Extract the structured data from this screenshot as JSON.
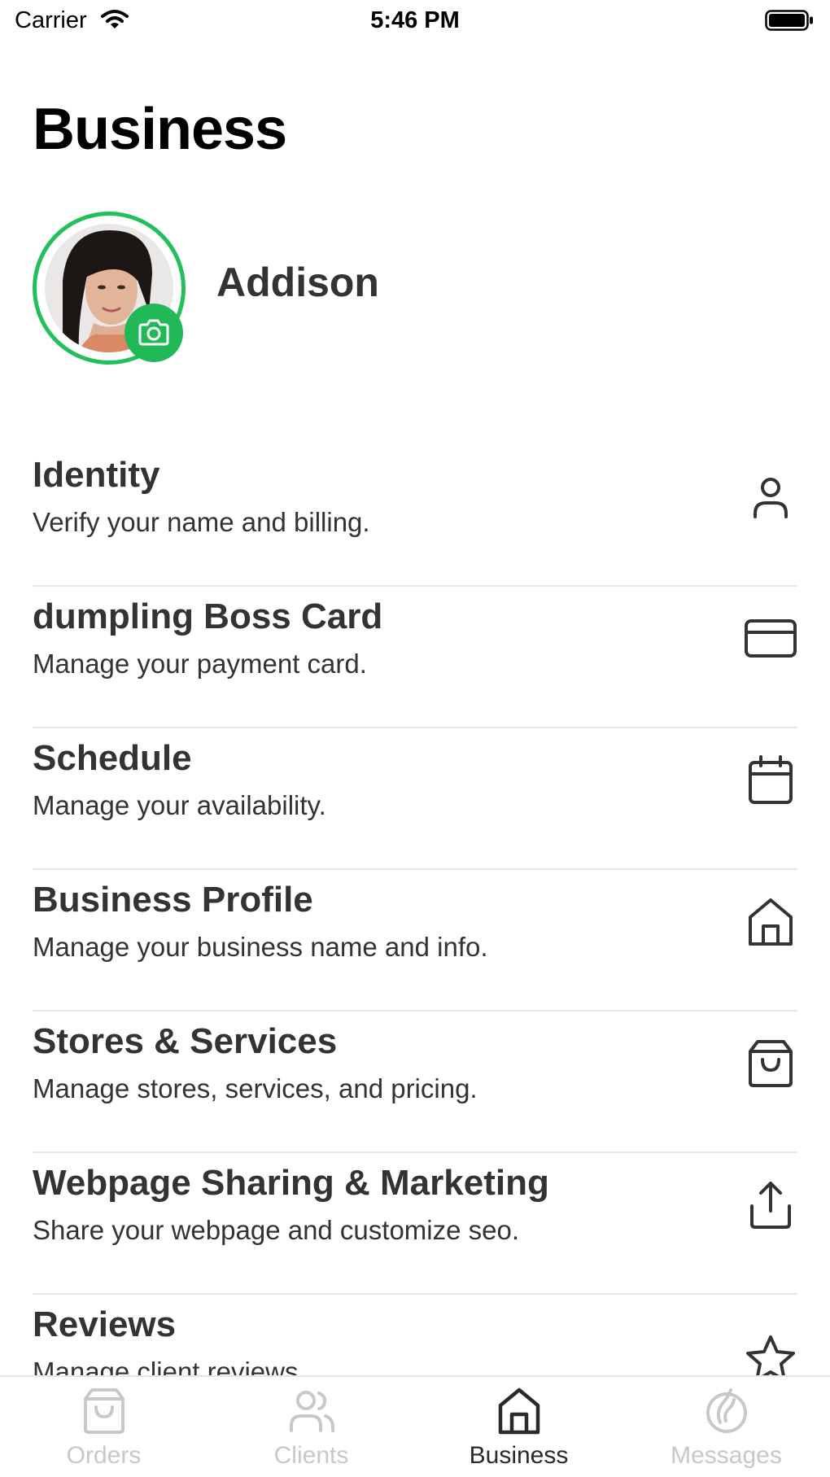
{
  "status_bar": {
    "carrier": "Carrier",
    "time": "5:46 PM"
  },
  "page_title": "Business",
  "profile": {
    "name": "Addison"
  },
  "menu": [
    {
      "title": "Identity",
      "subtitle": "Verify your name and billing.",
      "icon": "person-icon"
    },
    {
      "title": "dumpling Boss Card",
      "subtitle": "Manage your payment card.",
      "icon": "credit-card-icon"
    },
    {
      "title": "Schedule",
      "subtitle": "Manage your availability.",
      "icon": "calendar-icon"
    },
    {
      "title": "Business Profile",
      "subtitle": "Manage your business name and info.",
      "icon": "home-icon"
    },
    {
      "title": "Stores & Services",
      "subtitle": "Manage stores, services, and pricing.",
      "icon": "shopping-bag-icon"
    },
    {
      "title": "Webpage Sharing & Marketing",
      "subtitle": "Share your webpage and customize seo.",
      "icon": "share-icon"
    },
    {
      "title": "Reviews",
      "subtitle": "Manage client reviews.",
      "icon": "star-icon"
    }
  ],
  "tabs": [
    {
      "label": "Orders",
      "icon": "bag-icon",
      "active": false
    },
    {
      "label": "Clients",
      "icon": "users-icon",
      "active": false
    },
    {
      "label": "Business",
      "icon": "home-icon",
      "active": true
    },
    {
      "label": "Messages",
      "icon": "messages-icon",
      "active": false
    }
  ],
  "colors": {
    "accent": "#21b858",
    "text": "#333333",
    "inactive": "#c8c8c8"
  }
}
